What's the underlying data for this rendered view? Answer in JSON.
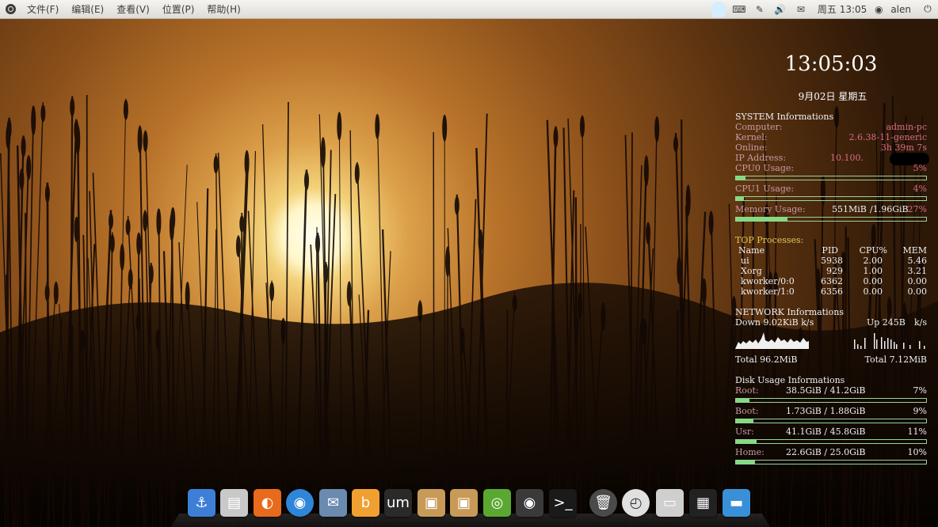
{
  "top_panel": {
    "menus": [
      "文件(F)",
      "编辑(E)",
      "查看(V)",
      "位置(P)",
      "帮助(H)"
    ],
    "datetime": "周五 13:05",
    "user": "alen",
    "icons": [
      "qq-icon",
      "keyboard-icon",
      "network-icon",
      "volume-icon",
      "mail-icon",
      "user-icon",
      "power-icon"
    ]
  },
  "conky": {
    "clock": "13:05:03",
    "date": "9月02日 星期五",
    "system": {
      "title": "SYSTEM Informations",
      "computer_label": "Computer:",
      "computer": "admin-pc",
      "kernel_label": "Kernel:",
      "kernel": "2.6.38-11-generic",
      "online_label": "Online:",
      "online": "3h 39m 7s",
      "ip_label": "IP Address:",
      "ip": "10.100.",
      "cpu0_label": "CPU0 Usage:",
      "cpu0": "5%",
      "cpu0_pct": 5,
      "cpu1_label": "CPU1 Usage:",
      "cpu1": "4%",
      "cpu1_pct": 4,
      "mem_label": "Memory Usage:",
      "mem_used": "551MiB",
      "mem_total": "/1.96GiB",
      "mem": "27%",
      "mem_pct": 27
    },
    "top": {
      "title": "TOP Processes:",
      "headers": [
        "Name",
        "PID",
        "CPU%",
        "MEM"
      ],
      "rows": [
        {
          "name": "ui",
          "pid": "5938",
          "cpu": "2.00",
          "mem": "5.46"
        },
        {
          "name": "Xorg",
          "pid": "929",
          "cpu": "1.00",
          "mem": "3.21"
        },
        {
          "name": "kworker/0:0",
          "pid": "6362",
          "cpu": "0.00",
          "mem": "0.00"
        },
        {
          "name": "kworker/1:0",
          "pid": "6356",
          "cpu": "0.00",
          "mem": "0.00"
        }
      ]
    },
    "network": {
      "title": "NETWORK Informations",
      "down": "Down 9.02KiB k/s",
      "up": "Up 245B",
      "up_unit": "k/s",
      "total_down": "Total 96.2MiB",
      "total_up": "Total 7.12MiB"
    },
    "disk": {
      "title": "Disk Usage Informations",
      "items": [
        {
          "label": "Root:",
          "usage": "38.5GiB / 41.2GiB",
          "pct_text": "7%",
          "pct": 7
        },
        {
          "label": "Boot:",
          "usage": "1.73GiB / 1.88GiB",
          "pct_text": "9%",
          "pct": 9
        },
        {
          "label": "Usr:",
          "usage": "41.1GiB / 45.8GiB",
          "pct_text": "11%",
          "pct": 11
        },
        {
          "label": "Home:",
          "usage": "22.6GiB / 25.0GiB",
          "pct_text": "10%",
          "pct": 10
        }
      ]
    }
  },
  "dock": {
    "apps": [
      {
        "name": "anchor-icon",
        "color": "#3d7fd6",
        "glyph": "⚓"
      },
      {
        "name": "file-cabinet-icon",
        "color": "#c9c9c9",
        "glyph": "▤"
      },
      {
        "name": "firefox-icon",
        "color": "#e86a1c",
        "glyph": "◐"
      },
      {
        "name": "globe-icon",
        "color": "#2f86d8",
        "glyph": "◉"
      },
      {
        "name": "mail-stamp-icon",
        "color": "#6a8ab0",
        "glyph": "✉"
      },
      {
        "name": "b-app-icon",
        "color": "#f0a030",
        "glyph": "b"
      },
      {
        "name": "um-video-icon",
        "color": "#2a2a2a",
        "glyph": "um"
      },
      {
        "name": "package-icon",
        "color": "#c89a58",
        "glyph": "▣"
      },
      {
        "name": "package-installer-icon",
        "color": "#c89a58",
        "glyph": "▣"
      },
      {
        "name": "ubuntu-software-icon",
        "color": "#5aa830",
        "glyph": "◎"
      },
      {
        "name": "camera-icon",
        "color": "#3a3a3a",
        "glyph": "◉"
      },
      {
        "name": "terminal-icon",
        "color": "#1a1a1a",
        "glyph": ">_"
      },
      {
        "name": "trash-icon",
        "color": "#4a4a4a",
        "glyph": "🗑"
      },
      {
        "name": "clock-icon",
        "color": "#e0e0e0",
        "glyph": "◴"
      },
      {
        "name": "drive-icon",
        "color": "#cfcfcf",
        "glyph": "▭"
      },
      {
        "name": "workspace-switcher-icon",
        "color": "#222222",
        "glyph": "▦"
      },
      {
        "name": "desktop-icon",
        "color": "#3a90d8",
        "glyph": "▬"
      }
    ]
  }
}
